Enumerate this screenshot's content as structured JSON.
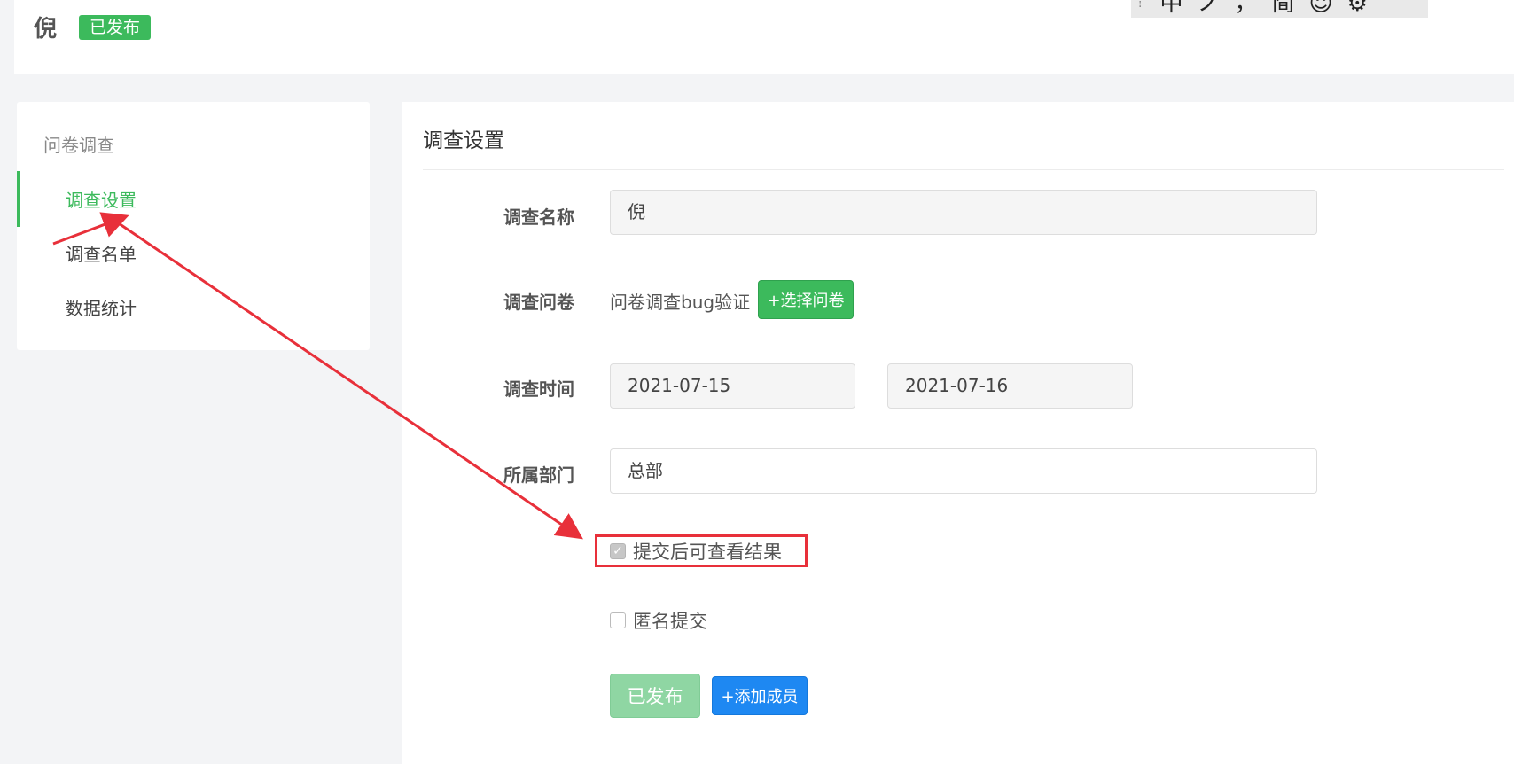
{
  "header": {
    "title": "倪",
    "status_badge": "已发布",
    "ime_toolbar": [
      "中",
      "ノ",
      "，",
      "简",
      "☺",
      "⚙"
    ]
  },
  "sidebar": {
    "group_title": "问卷调查",
    "items": [
      {
        "label": "调查设置",
        "active": true
      },
      {
        "label": "调查名单",
        "active": false
      },
      {
        "label": "数据统计",
        "active": false
      }
    ]
  },
  "main": {
    "panel_title": "调查设置",
    "fields": {
      "name_label": "调查名称",
      "name_value": "倪",
      "questionnaire_label": "调查问卷",
      "questionnaire_value": "问卷调查bug验证",
      "select_questionnaire_button": "+选择问卷",
      "time_label": "调查时间",
      "start_date": "2021-07-15",
      "end_date": "2021-07-16",
      "dept_label": "所属部门",
      "dept_value": "总部"
    },
    "checkboxes": [
      {
        "label": "提交后可查看结果",
        "checked": true
      },
      {
        "label": "匿名提交",
        "checked": false
      }
    ],
    "buttons": {
      "published": "已发布",
      "add_member": "+添加成员"
    }
  },
  "colors": {
    "accent_green": "#3cba5c",
    "accent_blue": "#1e88f2",
    "annotation_red": "#e8303a"
  }
}
